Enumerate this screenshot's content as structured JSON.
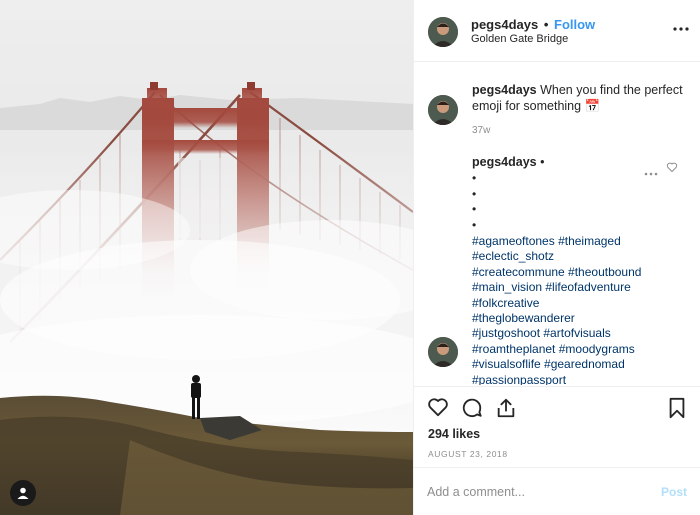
{
  "header": {
    "username": "pegs4days",
    "separator": "•",
    "follow_label": "Follow",
    "location": "Golden Gate Bridge",
    "more_icon": "more-horizontal-icon"
  },
  "caption": {
    "username": "pegs4days",
    "text": "When you find the perfect emoji for something",
    "emoji": "📅",
    "time": "37w"
  },
  "comment": {
    "username": "pegs4days",
    "separator": "•",
    "bullets": [
      "•",
      "•",
      "•",
      "•"
    ],
    "hashtags": [
      "#agameoftones #theimaged",
      "#eclectic_shotz",
      "#createcommune #theoutbound",
      "#main_vision #lifeofadventure",
      "#folkcreative",
      "#theglobewanderer",
      "#justgoshoot #artofvisuals",
      "#roamtheplanet #moodygrams",
      "#visualsoflife #gearednomad",
      "#passionpassport"
    ]
  },
  "actions": {
    "like_icon": "heart-icon",
    "comment_icon": "comment-icon",
    "share_icon": "share-icon",
    "save_icon": "bookmark-icon"
  },
  "likes": "294 likes",
  "date": "AUGUST 23, 2018",
  "add_comment": {
    "placeholder": "Add a comment...",
    "post_label": "Post"
  },
  "colors": {
    "link": "#3897f0",
    "hashtag": "#003569",
    "muted": "#8e8e8e",
    "post_disabled": "#b2dffc",
    "bridge": "#a4493d"
  }
}
